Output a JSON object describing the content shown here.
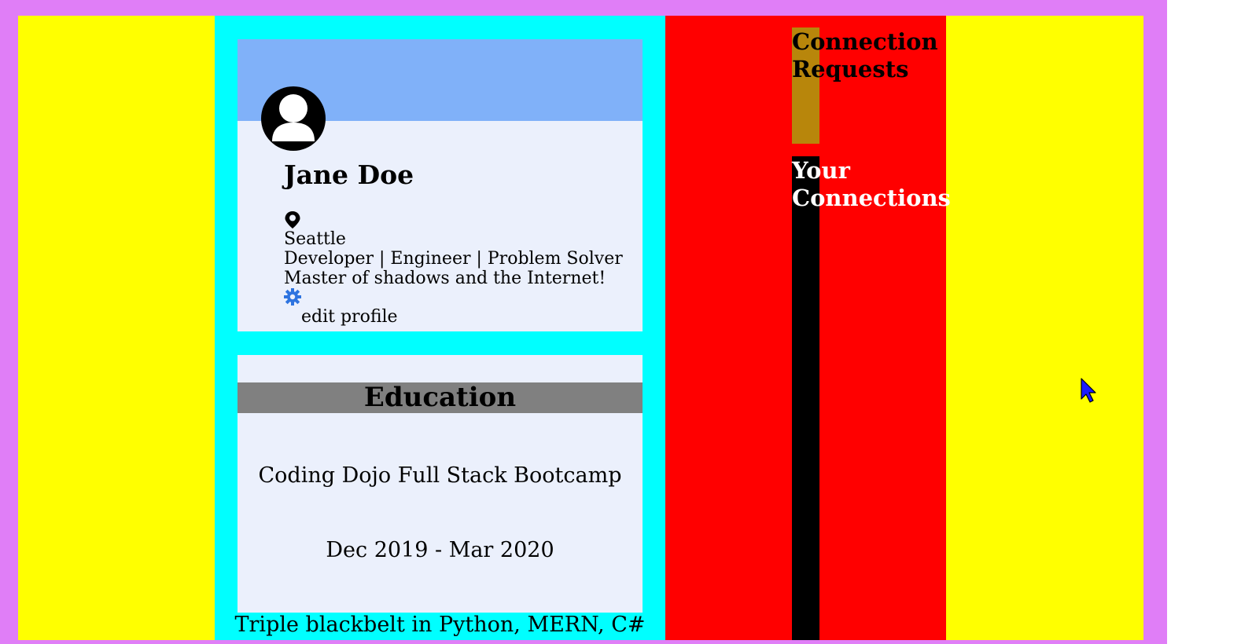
{
  "colors": {
    "frame": "#e07ef7",
    "side_column": "#ffff00",
    "center_column": "#00ffff",
    "right_column": "#ff0000",
    "card_bg": "#ebf0fc",
    "banner": "#80b1f9",
    "section_header": "#808080",
    "requests_accent": "#b8860b",
    "connections_accent": "#000000",
    "gear": "#2e74e0"
  },
  "profile": {
    "name": "Jane Doe",
    "location": "Seattle",
    "headline": "Developer | Engineer | Problem Solver",
    "bio": "Master of shadows and the Internet!",
    "edit_label": "edit profile",
    "icons": {
      "avatar": "user-avatar-icon",
      "location": "map-pin-icon",
      "settings": "gear-icon"
    }
  },
  "education": {
    "title": "Education",
    "school": "Coding Dojo Full Stack Bootcamp",
    "dates": "Dec 2019 - Mar 2020",
    "note": "Triple blackbelt in Python, MERN, C#"
  },
  "sidebar": {
    "requests_title": "Connection Requests",
    "connections_title": "Your Connections"
  }
}
